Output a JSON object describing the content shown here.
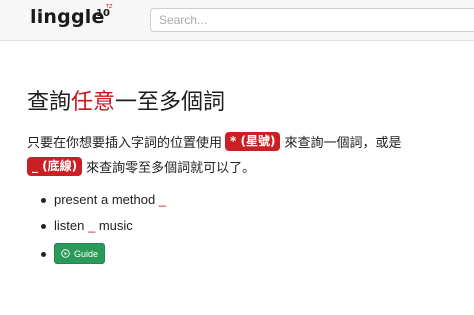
{
  "header": {
    "logo": "linggle",
    "logo_sup": "10",
    "logo_tz": "TZ",
    "search_placeholder": "Search..."
  },
  "main": {
    "title_before": "查詢",
    "title_highlight": "任意",
    "title_after": "一至多個詞",
    "line1_before": "只要在你想要插入字詞的位置使用",
    "tag_star": "* (星號)",
    "line1_after": "來查詢一個詞，或是",
    "tag_underscore": "_ (底線)",
    "line2_after": "來查詢零至多個詞就可以了。",
    "examples": [
      {
        "text": "present a method ",
        "blank": "_"
      },
      {
        "text_before": "listen ",
        "blank": "_",
        "text_after": " music"
      }
    ],
    "guide_label": "Guide"
  },
  "colors": {
    "accent_red": "#c8161d",
    "guide_green": "#2a9a5b",
    "navbar_bg": "#f7f7f7"
  },
  "icons": {
    "guide_icon": "circle-play-icon"
  }
}
